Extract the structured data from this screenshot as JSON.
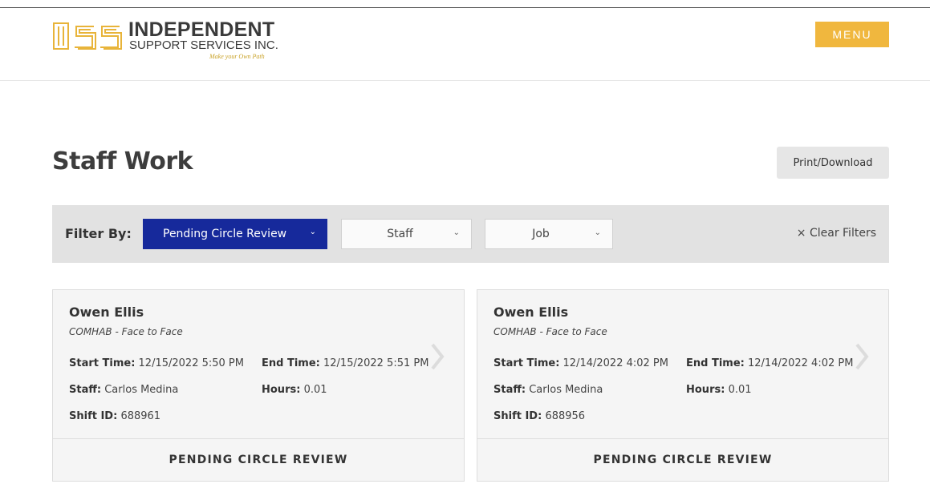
{
  "header": {
    "logo_name": "INDEPENDENT",
    "logo_sub": "SUPPORT SERVICES INC.",
    "logo_tagline": "Make your Own Path",
    "menu_label": "MENU",
    "accent_color": "#f0b73e"
  },
  "page": {
    "title": "Staff Work",
    "print_label": "Print/Download"
  },
  "filters": {
    "label": "Filter By:",
    "status": "Pending Circle Review",
    "staff": "Staff",
    "job": "Job",
    "clear": "× Clear Filters",
    "status_color": "#16299b"
  },
  "labels": {
    "start": "Start Time:",
    "end": "End Time:",
    "staff": "Staff:",
    "hours": "Hours:",
    "shift": "Shift ID:"
  },
  "cards": [
    {
      "name": "Owen Ellis",
      "job": "COMHAB - Face to Face",
      "start": "12/15/2022 5:50 PM",
      "end": "12/15/2022 5:51 PM",
      "staff": "Carlos Medina",
      "hours": "0.01",
      "shift_id": "688961",
      "status": "PENDING CIRCLE REVIEW"
    },
    {
      "name": "Owen Ellis",
      "job": "COMHAB - Face to Face",
      "start": "12/14/2022 4:02 PM",
      "end": "12/14/2022 4:02 PM",
      "staff": "Carlos Medina",
      "hours": "0.01",
      "shift_id": "688956",
      "status": "PENDING CIRCLE REVIEW"
    }
  ]
}
